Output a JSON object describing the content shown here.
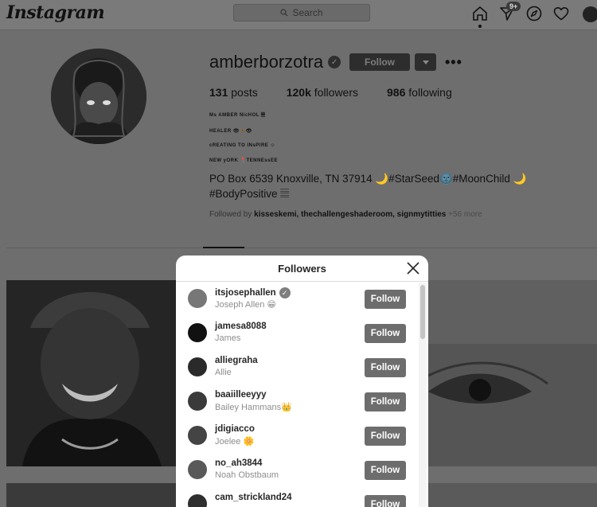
{
  "app": {
    "logo": "Instagram"
  },
  "nav": {
    "search_placeholder": "Search",
    "dm_badge": "9+"
  },
  "profile": {
    "username": "amberborzotra",
    "verified_mark": "✓",
    "follow_label": "Follow",
    "more_label": "•••",
    "stats": {
      "posts_count": "131",
      "posts_label": "posts",
      "followers_count": "120k",
      "followers_label": "followers",
      "following_count": "986",
      "following_label": "following"
    },
    "bio_lines": [
      "Ms AMBER NicHOL 𝄚",
      "HEALER 👁🦋👁",
      "cREATING TO INsPIRE ☺",
      "NEW yORK 📍TENNEssEE"
    ],
    "bio_main": "PO Box 6539 Knoxville, TN 37914 🌙#StarSeed🌚#MoonChild 🌙 #BodyPositive 𝄚",
    "followed_by_prefix": "Followed by",
    "followed_by_names": "kisseskemi, thechallengeshaderoom, signmytitties",
    "followed_by_more": "+56 more"
  },
  "modal": {
    "title": "Followers",
    "close_label": "Close",
    "follow_label": "Follow",
    "followers": [
      {
        "username": "itsjosephallen",
        "name": "Joseph Allen 😁",
        "verified": true
      },
      {
        "username": "jamesa8088",
        "name": "James",
        "verified": false
      },
      {
        "username": "alliegraha",
        "name": "Allie",
        "verified": false
      },
      {
        "username": "baaiilleeyyy",
        "name": "Bailey Hammans👑",
        "verified": false
      },
      {
        "username": "jdigiacco",
        "name": "Joelee 🌼",
        "verified": false
      },
      {
        "username": "no_ah3844",
        "name": "Noah Obstbaum",
        "verified": false
      },
      {
        "username": "cam_strickland24",
        "name": "",
        "verified": false
      }
    ]
  },
  "icons": {
    "home": "home-icon",
    "direct": "direct-icon",
    "explore": "explore-icon",
    "activity": "heart-icon",
    "close": "close-icon",
    "search": "search-icon"
  },
  "colors": {
    "overlay_bg": "#6e6e6e",
    "modal_bg": "#ffffff",
    "follow_button": "#6d6d6d",
    "muted_text": "#8e8e8e"
  }
}
